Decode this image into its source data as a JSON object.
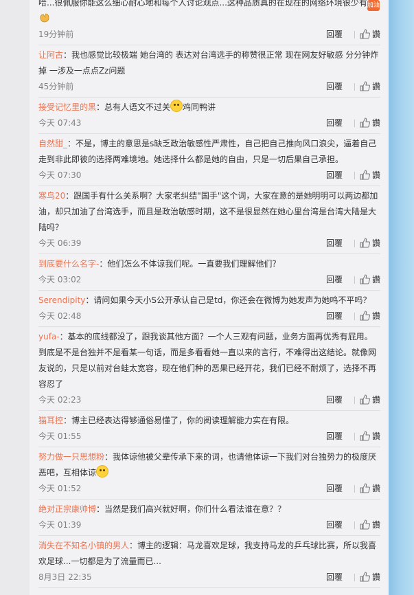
{
  "comments": [
    {
      "author": "",
      "text": "哈...很佩服你能这么细心耐心地和每个人讨论观点...这种品质真的在现在的网络环境很少有",
      "time": "19分钟前",
      "reply": "回覆",
      "like": "讚"
    },
    {
      "author": "让阿古",
      "text": "我也感觉比较极端 她台湾的 表达对台湾选手的称赞很正常 现在网友好敏感 分分钟炸掉 一涉及一点点Zz问题",
      "time": "45分钟前",
      "reply": "回覆",
      "like": "讚"
    },
    {
      "author": "接受记忆里的黑",
      "text_before": "总有人语文不过关",
      "text_after": "鸡同鸭讲",
      "time": "今天 07:43",
      "reply": "回覆",
      "like": "讚"
    },
    {
      "author": "自然甜_",
      "text": "不是，博主的意思是s缺乏政治敏感性严肃性，自己把自己推向风口浪尖，逼着自己走到非此即彼的选择两难境地。她选择什么都是她的自由，只是一切后果自己承担。",
      "time": "今天 07:30",
      "reply": "回覆",
      "like": "讚"
    },
    {
      "author": "寒鸟20",
      "text": "跟国手有什么关系啊？大家老纠结\"国手\"这个词，大家在意的是她明明可以两边都加油，却只加油了台湾选手，而且是政治敏感时期，这不是很显然在她心里台湾是台湾大陆是大陆吗？",
      "time": "今天 06:39",
      "reply": "回覆",
      "like": "讚"
    },
    {
      "author": "到底要什么名字-",
      "text": "他们怎么不体谅我们呢。一直要我们理解他们？",
      "time": "今天 03:02",
      "reply": "回覆",
      "like": "讚"
    },
    {
      "author": "Serendipity",
      "text": "请问如果今天小S公开承认自己是td，你还会在微博为她发声为她鸣不平吗？",
      "time": "今天 02:48",
      "reply": "回覆",
      "like": "讚"
    },
    {
      "author": "yufa-",
      "text": "基本的底线都没了，跟我谈其他方面？一个人三观有问题，业务方面再优秀有屁用。到底是不是台独并不是看某一句话，而是多看看她一直以来的言行，不难得出这结论。就像网友说的，只是以前对台蛙太宽容，现在他们种的恶果已经开花，我们已经不耐烦了，选择不再容忍了",
      "time": "今天 02:23",
      "reply": "回覆",
      "like": "讚"
    },
    {
      "author": "猫耳控",
      "text": "博主已经表达得够通俗易懂了，你的阅读理解能力实在有限。",
      "time": "今天 01:55",
      "reply": "回覆",
      "like": "讚"
    },
    {
      "author": "努力做一只思想粉",
      "text": "我体谅他被父辈传承下来的词，也请他体谅一下我们对台独势力的极度厌恶吧，互相体谅",
      "time": "今天 01:52",
      "reply": "回覆",
      "like": "讚"
    },
    {
      "author": "绝对正宗康帅博",
      "text": "当然是我们高兴就好啊，你们什么看法谁在意？？",
      "time": "今天 01:39",
      "reply": "回覆",
      "like": "讚"
    },
    {
      "author": "消失在不知名小镇的男人",
      "text": "博主的逻辑：马龙喜欢足球，我支持马龙的乒乓球比赛，所以我喜欢足球...一切都是为了流量而已...",
      "time": "8月3日 22:35",
      "reply": "回覆",
      "like": "讚"
    }
  ],
  "emoji_jiayou_label": "加油",
  "colors": {
    "author": "#eb7350",
    "panel_bg": "#f2f2f5",
    "page_bg": "#eaeaec",
    "strip": "#a7d3ef"
  }
}
